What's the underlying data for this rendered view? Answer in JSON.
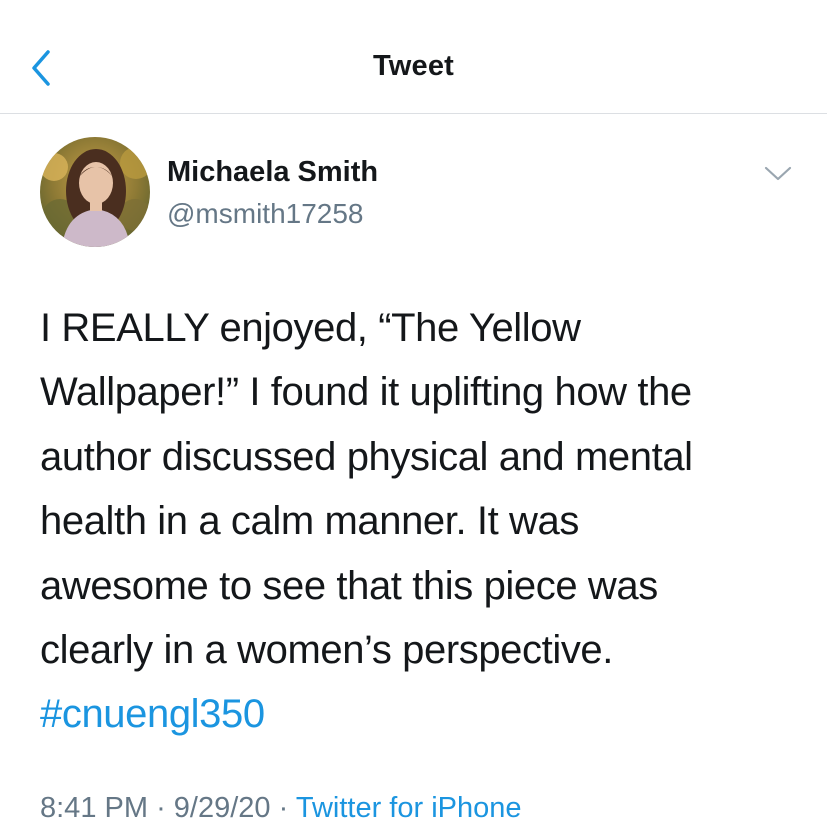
{
  "header": {
    "title": "Tweet",
    "back_icon": "chevron-left-icon"
  },
  "author": {
    "name": "Michaela Smith",
    "handle": "@msmith17258"
  },
  "tweet": {
    "lines": [
      "I REALLY enjoyed, “The Yellow",
      "Wallpaper!” I found it uplifting how the",
      "author discussed physical and mental",
      "health in a calm manner. It was",
      "awesome to see that this piece was",
      "clearly in a women’s perspective."
    ],
    "hashtag": "#cnuengl350"
  },
  "meta": {
    "time": "8:41 PM",
    "separator": "·",
    "date": "9/29/20",
    "source": "Twitter for iPhone"
  },
  "colors": {
    "accent": "#1b95e0",
    "text": "#14171a",
    "secondary": "#657786",
    "divider": "#dcdfe3"
  }
}
